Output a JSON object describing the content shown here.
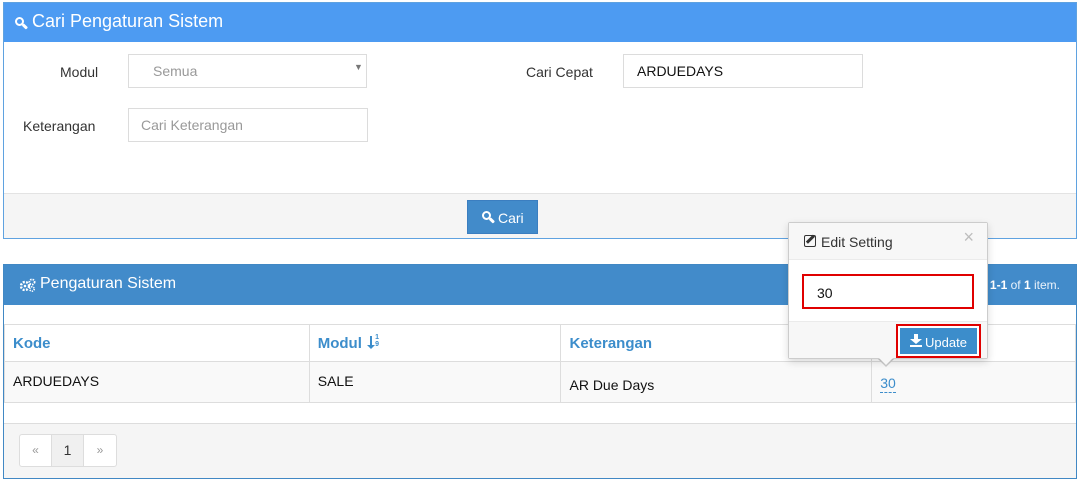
{
  "search": {
    "title": "Cari Pengaturan Sistem",
    "modul_label": "Modul",
    "modul_selected": "Semua",
    "cari_cepat_label": "Cari Cepat",
    "cari_cepat_value": "ARDUEDAYS",
    "keterangan_label": "Keterangan",
    "keterangan_placeholder": "Cari Keterangan",
    "submit_label": "Cari"
  },
  "settings": {
    "title": "Pengaturan Sistem",
    "summary": {
      "range": "1-1",
      "of": "of",
      "total": "1",
      "unit": "item."
    },
    "columns": [
      "Kode",
      "Modul",
      "Keterangan"
    ],
    "rows": [
      {
        "kode": "ARDUEDAYS",
        "modul": "SALE",
        "keterangan": "AR Due Days",
        "nilai": "30"
      }
    ],
    "pagination": {
      "prev": "«",
      "current": "1",
      "next": "»"
    }
  },
  "popover": {
    "title": "Edit Setting",
    "close": "×",
    "value": "30",
    "update_label": "Update"
  },
  "colors": {
    "header_blue": "#4d9bf2",
    "panel_blue": "#428bca",
    "highlight_red": "#e00000"
  }
}
